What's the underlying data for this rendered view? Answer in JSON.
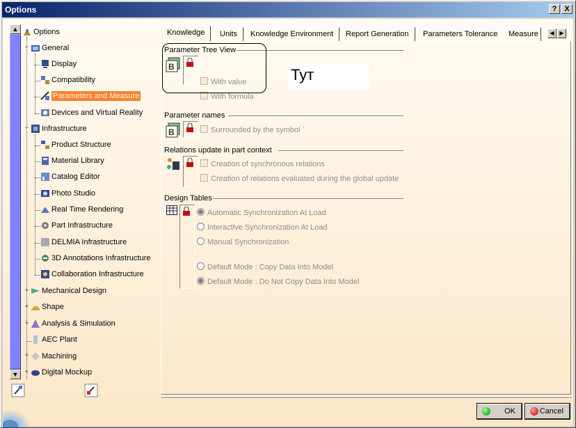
{
  "window": {
    "title": "Options",
    "help_label": "?",
    "close_label": "X"
  },
  "tree": {
    "root": "Options",
    "items": [
      {
        "label": "General",
        "icon": "general-icon",
        "level": 0
      },
      {
        "label": "Display",
        "icon": "display-icon",
        "level": 1
      },
      {
        "label": "Compatibility",
        "icon": "compatibility-icon",
        "level": 1
      },
      {
        "label": "Parameters and Measure",
        "icon": "parameters-icon",
        "level": 1,
        "selected": true
      },
      {
        "label": "Devices and Virtual Reality",
        "icon": "devices-icon",
        "level": 1
      },
      {
        "label": "Infrastructure",
        "icon": "infrastructure-icon",
        "level": 0
      },
      {
        "label": "Product Structure",
        "icon": "product-structure-icon",
        "level": 1
      },
      {
        "label": "Material Library",
        "icon": "material-library-icon",
        "level": 1
      },
      {
        "label": "Catalog Editor",
        "icon": "catalog-editor-icon",
        "level": 1
      },
      {
        "label": "Photo Studio",
        "icon": "photo-studio-icon",
        "level": 1
      },
      {
        "label": "Real Time Rendering",
        "icon": "rendering-icon",
        "level": 1
      },
      {
        "label": "Part Infrastructure",
        "icon": "part-infrastructure-icon",
        "level": 1
      },
      {
        "label": "DELMIA Infrastructure",
        "icon": "delmia-icon",
        "level": 1
      },
      {
        "label": "3D Annotations Infrastructure",
        "icon": "annotations-icon",
        "level": 1
      },
      {
        "label": "Collaboration Infrastructure",
        "icon": "collaboration-icon",
        "level": 1
      },
      {
        "label": "Mechanical Design",
        "icon": "mechanical-design-icon",
        "level": 0
      },
      {
        "label": "Shape",
        "icon": "shape-icon",
        "level": 0
      },
      {
        "label": "Analysis & Simulation",
        "icon": "analysis-icon",
        "level": 0
      },
      {
        "label": "AEC Plant",
        "icon": "aec-plant-icon",
        "level": 0
      },
      {
        "label": "Machining",
        "icon": "machining-icon",
        "level": 0
      },
      {
        "label": "Digital Mockup",
        "icon": "digital-mockup-icon",
        "level": 0
      }
    ]
  },
  "tabs": [
    "Knowledge",
    "Units",
    "Knowledge Environment",
    "Report Generation",
    "Parameters Tolerance",
    "Measure"
  ],
  "active_tab": "Knowledge",
  "groups": {
    "tree_view": {
      "title": "Parameter Tree View",
      "with_value": "With value",
      "with_formula": "With formula"
    },
    "names": {
      "title": "Parameter names",
      "surrounded": "Surrounded by the symbol `"
    },
    "relations": {
      "title": "Relations update in part context",
      "sync": "Creation of synchronous relations",
      "global": "Creation of relations evaluated during the global update"
    },
    "design_tables": {
      "title": "Design Tables",
      "auto": "Automatic Synchronization At Load",
      "interactive": "Interactive Synchronization At Load",
      "manual": "Manual Synchronization",
      "copy": "Default Mode : Copy Data Into Model",
      "nocopy": "Default Mode : Do Not Copy Data Into Model"
    }
  },
  "annotation": "Тут",
  "buttons": {
    "ok": "OK",
    "cancel": "Cancel"
  },
  "colors": {
    "selection": "#ff7f27",
    "title_bar": "#0a246a",
    "scroll_thumb": "#8282ff"
  }
}
